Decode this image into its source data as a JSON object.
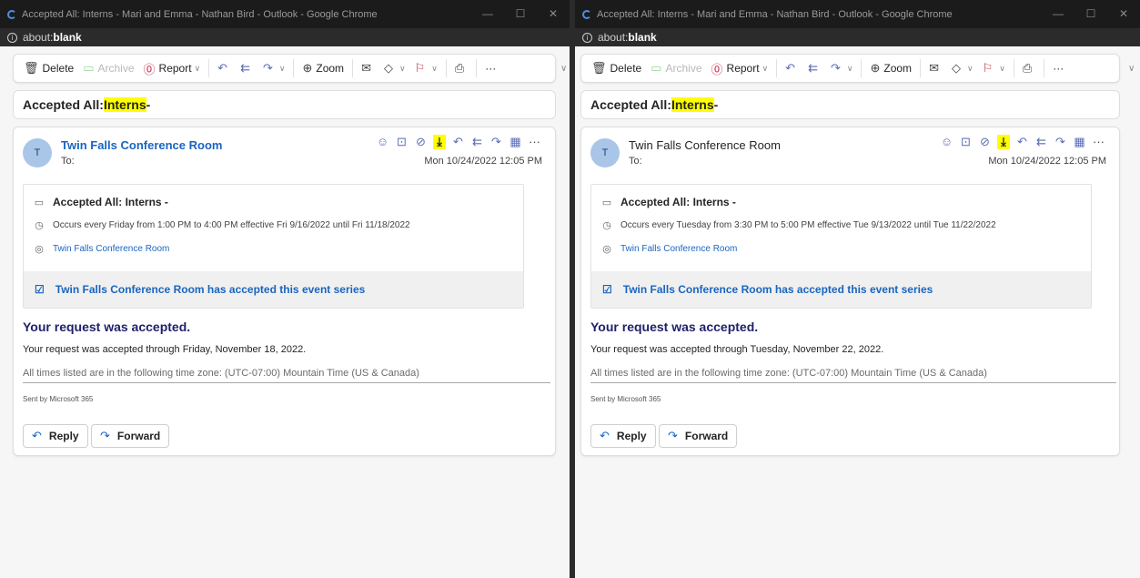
{
  "left": {
    "window_title": "Accepted All: Interns - Mari and Emma - Nathan Bird - Outlook - Google Chrome",
    "address_prefix": "about:",
    "address_host": "blank",
    "toolbar": {
      "delete": "Delete",
      "archive": "Archive",
      "report": "Report",
      "zoom": "Zoom",
      "more": "···"
    },
    "subject_prefix": "Accepted All: ",
    "subject_highlight": "Interns",
    "subject_suffix": " -",
    "avatar_initial": "T",
    "sender": "Twin Falls Conference Room",
    "to_label": "To:",
    "date": "Mon 10/24/2022 12:05 PM",
    "invite": {
      "title": "Accepted All: Interns -",
      "recurrence": "Occurs every Friday from 1:00 PM to 4:00 PM effective Fri 9/16/2022 until Fri 11/18/2022",
      "location": "Twin Falls Conference Room",
      "accepted": "Twin Falls Conference Room has accepted this event series"
    },
    "request_heading": "Your request was accepted.",
    "request_text": "Your request was accepted through Friday, November 18, 2022.",
    "timezone_text": "All times listed are in the following time zone: (UTC-07:00) Mountain Time (US & Canada)",
    "sent_by": "Sent by Microsoft 365",
    "reply": "Reply",
    "forward": "Forward"
  },
  "right": {
    "window_title": "Accepted All: Interns - Mari and Emma - Nathan Bird - Outlook - Google Chrome",
    "address_prefix": "about:",
    "address_host": "blank",
    "toolbar": {
      "delete": "Delete",
      "archive": "Archive",
      "report": "Report",
      "zoom": "Zoom",
      "more": "···"
    },
    "subject_prefix": "Accepted All: ",
    "subject_highlight": "Interns",
    "subject_suffix": " -",
    "avatar_initial": "T",
    "sender": "Twin Falls Conference Room",
    "to_label": "To:",
    "date": "Mon 10/24/2022 12:05 PM",
    "invite": {
      "title": "Accepted All: Interns -",
      "recurrence": "Occurs every Tuesday from 3:30 PM to 5:00 PM effective Tue 9/13/2022 until Tue 11/22/2022",
      "location": "Twin Falls Conference Room",
      "accepted": "Twin Falls Conference Room has accepted this event series"
    },
    "request_heading": "Your request was accepted.",
    "request_text": "Your request was accepted through Tuesday, November 22, 2022.",
    "timezone_text": "All times listed are in the following time zone: (UTC-07:00) Mountain Time (US & Canada)",
    "sent_by": "Sent by Microsoft 365",
    "reply": "Reply",
    "forward": "Forward"
  },
  "colors": {
    "accent": "#1a65c0",
    "highlight": "#ffff00",
    "heading": "#1f1f6b",
    "titlebar": "#1b1b1b"
  },
  "icons": [
    "loading-spinner-icon",
    "info-icon",
    "trash-icon",
    "archive-icon",
    "report-icon",
    "reply-icon",
    "reply-all-icon",
    "forward-icon",
    "zoom-icon",
    "read-icon",
    "tag-icon",
    "flag-icon",
    "print-icon",
    "emoji-icon",
    "calendar-icon",
    "clock-icon",
    "location-icon",
    "accepted-calendar-icon",
    "download-icon",
    "apps-icon"
  ]
}
